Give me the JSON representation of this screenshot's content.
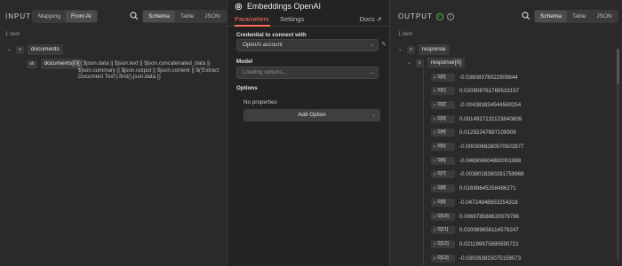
{
  "input": {
    "title": "INPUT",
    "source_tabs": [
      "Mapping",
      "From AI"
    ],
    "source_active": 1,
    "view_tabs": [
      "Schema",
      "Table",
      "JSON"
    ],
    "view_active": 0,
    "items_count": "1 item",
    "root_field": "documents",
    "child_field": "documents[0]",
    "child_type": "ab",
    "expression": "{{ $json.data || $json.text || $json.concatenated_data || $json.summary || $json.output || $json.content || $('Extract Document Text').first().json.data }}"
  },
  "node": {
    "title": "Embeddings OpenAI",
    "tabs": [
      "Parameters",
      "Settings"
    ],
    "active_tab": 0,
    "docs_label": "Docs",
    "credential_label": "Credential to connect with",
    "credential_value": "OpenAi account",
    "model_label": "Model",
    "model_placeholder": "Loading options...",
    "options_label": "Options",
    "no_properties": "No properties",
    "add_option_label": "Add Option"
  },
  "output": {
    "title": "OUTPUT",
    "view_tabs": [
      "Schema",
      "Table",
      "JSON"
    ],
    "view_active": 0,
    "items_count": "1 item",
    "root_field": "response",
    "sub_field": "response[0]",
    "values": [
      {
        "key": "0[0]",
        "value": "-0.03608378022909644"
      },
      {
        "key": "0[1]",
        "value": "0.020908761769533157"
      },
      {
        "key": "0[2]",
        "value": "-0.004383834544569254"
      },
      {
        "key": "0[3]",
        "value": "0.0014927131123840809"
      },
      {
        "key": "0[4]",
        "value": "0.01292247697109909"
      },
      {
        "key": "0[5]",
        "value": "-0.0003068280570502877"
      },
      {
        "key": "0[6]",
        "value": "-0.046904604882001888"
      },
      {
        "key": "0[7]",
        "value": "-0.0038018380291759968"
      },
      {
        "key": "0[8]",
        "value": "0.01699645258486271"
      },
      {
        "key": "0[9]",
        "value": "-0.04724948853254318"
      },
      {
        "key": "0[10]",
        "value": "0.006978568620979786"
      },
      {
        "key": "0[11]",
        "value": "0.020089656114578247"
      },
      {
        "key": "0[12]",
        "value": "0.021199975890590721"
      },
      {
        "key": "0[13]",
        "value": "-0.030263815075159073"
      },
      {
        "key": "0[14]",
        "value": "0.027375388890504837"
      }
    ]
  },
  "colors": {
    "accent": "#ff6d5a",
    "success": "#4caf50"
  }
}
